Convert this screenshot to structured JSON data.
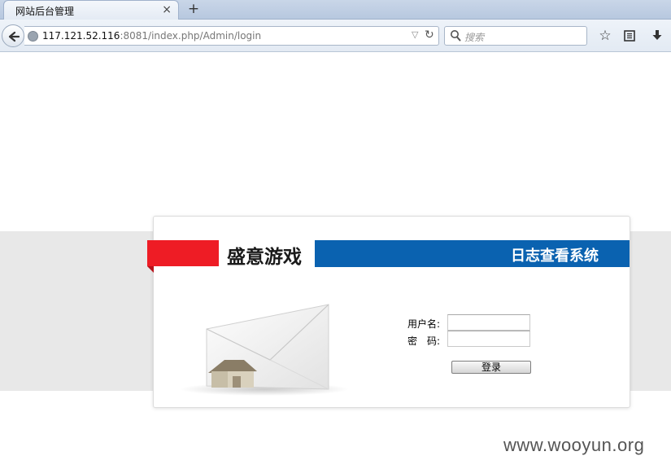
{
  "browser": {
    "tab": {
      "title": "网站后台管理",
      "close": "×"
    },
    "new_tab": "+",
    "url": {
      "host": "117.121.52.116",
      "rest": ":8081/index.php/Admin/login"
    },
    "search": {
      "placeholder": "搜索"
    },
    "icons": [
      "back-arrow-icon",
      "globe-icon",
      "dropdown-icon",
      "reload-icon",
      "search-icon",
      "bookmark-star-icon",
      "reading-list-icon",
      "download-icon"
    ]
  },
  "header": {
    "brand": "盛意游戏",
    "system_title": "日志查看系统"
  },
  "login": {
    "username_label": "用户名:",
    "password_label": "密　码:",
    "username_value": "",
    "password_value": "",
    "submit_label": "登录"
  },
  "watermark": "www.wooyun.org",
  "colors": {
    "brand_red": "#ee1c25",
    "brand_blue": "#0a62b0",
    "band_gray": "#e8e8e8"
  }
}
